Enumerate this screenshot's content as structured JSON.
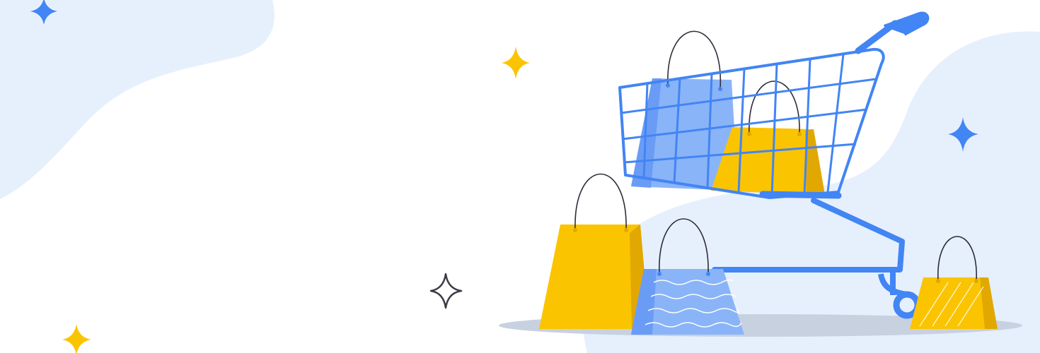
{
  "banner": {
    "colors": {
      "background": "#ffffff",
      "blob": "#e6f0fd",
      "accent_blue": "#4285f4",
      "light_blue": "#8ab4f8",
      "mid_blue": "#6a9cf6",
      "yellow": "#fbc400",
      "dark_yellow": "#e0a800",
      "outline_star": "#3c3c46",
      "shadow": "#c8d1e0",
      "handle": "#2d2d3a"
    },
    "icons": [
      "sparkle-icon",
      "shopping-cart-icon",
      "shopping-bag-icon"
    ]
  }
}
